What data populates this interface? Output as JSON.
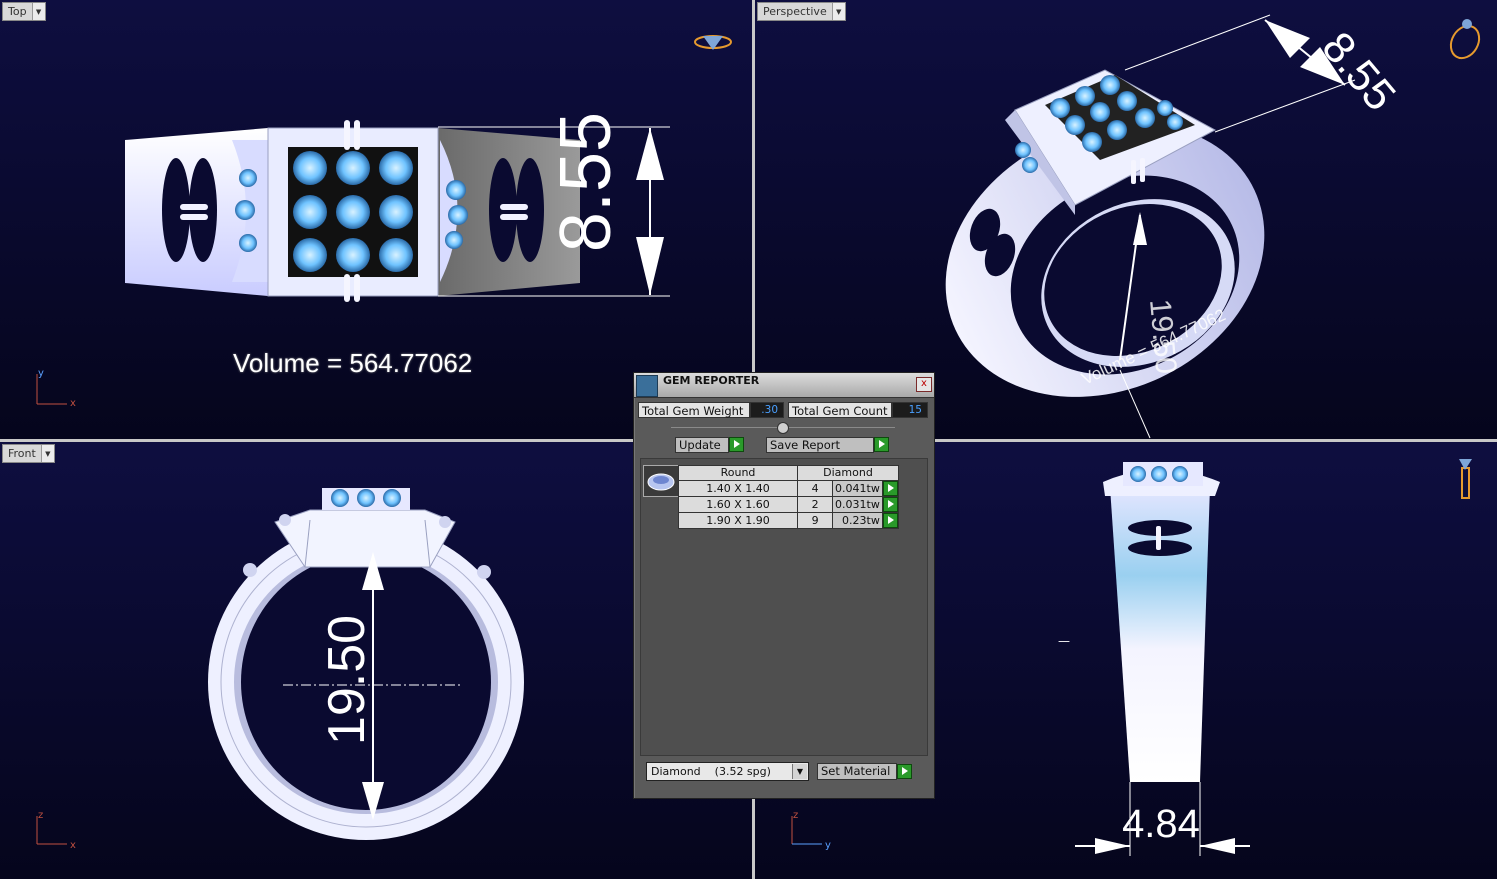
{
  "viewports": {
    "top": {
      "label": "Top",
      "volume_text": "Volume = 564.77062",
      "dimension": "8.55",
      "axes": [
        "y",
        "x"
      ]
    },
    "perspective": {
      "label": "Perspective",
      "dimension": "8.55",
      "dimension2": "19.50",
      "volume_text": "Volume = 564.77062"
    },
    "front": {
      "label": "Front",
      "dimension": "19.50",
      "axes": [
        "z",
        "x"
      ]
    },
    "right": {
      "dimension": "4.84",
      "axes": [
        "z",
        "y"
      ],
      "small_mark": "—"
    }
  },
  "gem_reporter": {
    "title": "GEM REPORTER",
    "close_label": "x",
    "total_weight_label": "Total Gem Weight",
    "total_weight_value": ".30",
    "total_count_label": "Total Gem Count",
    "total_count_value": "15",
    "update_label": "Update",
    "save_report_label": "Save Report",
    "table": {
      "headers": [
        "Round",
        "Diamond"
      ],
      "rows": [
        {
          "size": "1.40 X 1.40",
          "count": "4",
          "weight": "0.041tw"
        },
        {
          "size": "1.60 X 1.60",
          "count": "2",
          "weight": "0.031tw"
        },
        {
          "size": "1.90 X 1.90",
          "count": "9",
          "weight": "0.23tw"
        }
      ]
    },
    "material_select": "Diamond    (3.52 spg)",
    "set_material_label": "Set Material"
  },
  "colors": {
    "viewport_bg": "#0a0a30",
    "gem_blue": "#6fc3ff",
    "metal": "#e8ecff",
    "go_green": "#2a9a2a"
  }
}
